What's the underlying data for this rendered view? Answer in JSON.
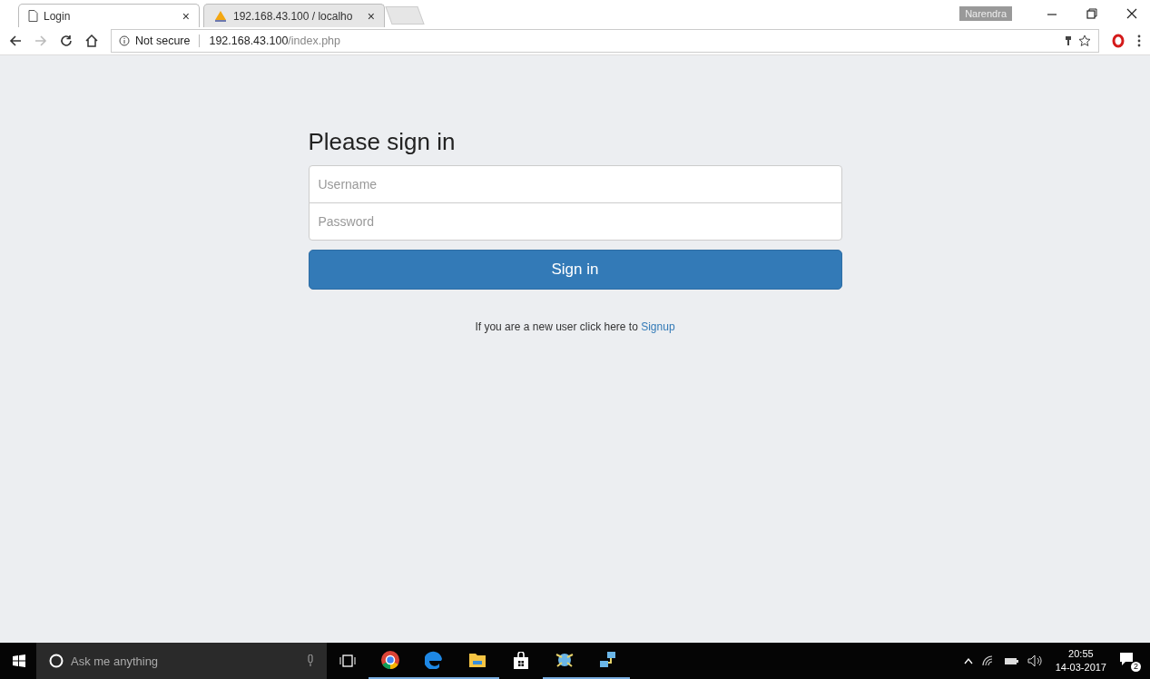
{
  "browser": {
    "tabs": [
      {
        "title": "Login",
        "selected": true,
        "close": "×",
        "kind": "page"
      },
      {
        "title": "192.168.43.100 / localho",
        "selected": false,
        "close": "×",
        "kind": "pma"
      }
    ],
    "profile": "Narendra",
    "address": {
      "security": "Not secure",
      "host": "192.168.43.100",
      "path": "/index.php"
    }
  },
  "form": {
    "heading": "Please sign in",
    "fields": [
      {
        "placeholder": "Username"
      },
      {
        "placeholder": "Password"
      }
    ],
    "button": "Sign in",
    "footer": "If you are a new user click here to",
    "link": "Signup"
  },
  "taskbar": {
    "search": {
      "placeholder": "Ask me anything"
    },
    "apps": [
      {
        "kind": "chrome",
        "running": true
      },
      {
        "kind": "edge",
        "running": true
      },
      {
        "kind": "folder",
        "running": true
      },
      {
        "kind": "store",
        "running": false
      },
      {
        "kind": "network",
        "running": true
      },
      {
        "kind": "connect",
        "running": true
      }
    ],
    "time": "20:55",
    "date": "14-03-2017",
    "notifications": "2"
  }
}
